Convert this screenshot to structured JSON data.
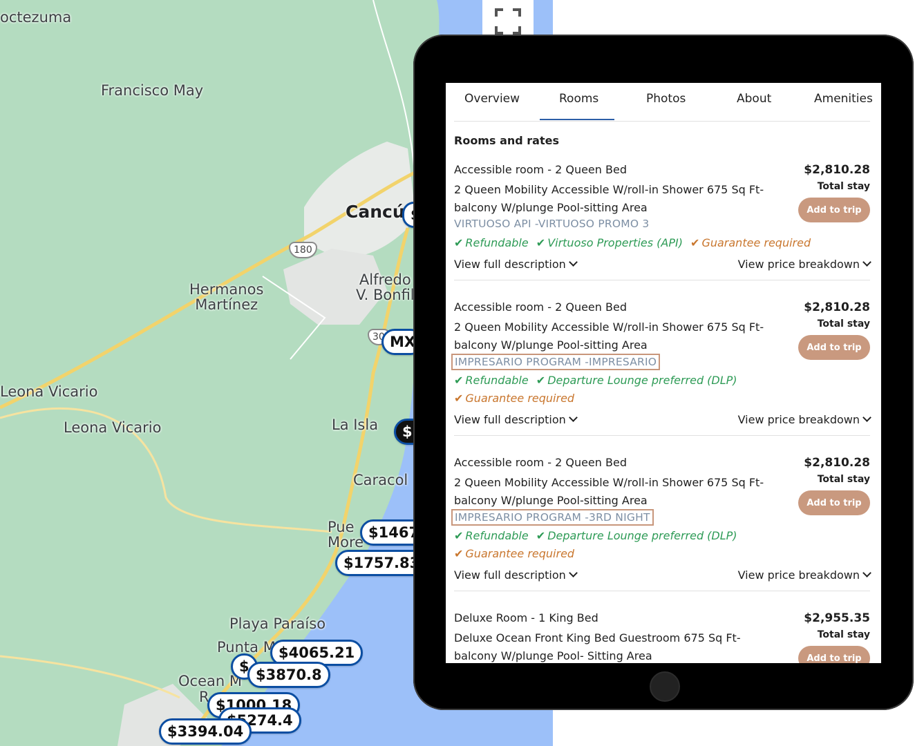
{
  "map": {
    "places": [
      {
        "label": "octezuma"
      },
      {
        "label": "Francisco May"
      },
      {
        "label": "Cancú"
      },
      {
        "label": "Hermanos\nMartínez"
      },
      {
        "label": "Alfredo\nV. Bonfil"
      },
      {
        "label": "Leona Vicario"
      },
      {
        "label": "Leona Vicario"
      },
      {
        "label": "La Isla"
      },
      {
        "label": "Caracol"
      },
      {
        "label": "Pue\nMore"
      },
      {
        "label": "Playa Paraíso"
      },
      {
        "label": "Punta M"
      },
      {
        "label": "Ocean M"
      },
      {
        "label": "R"
      }
    ],
    "road_shields": [
      "180",
      "30"
    ],
    "price_pins": [
      "$1467",
      "$1757.83",
      "$4065.21",
      "$3870.8",
      "$",
      "$1000.18",
      "$5274.4",
      "$3394.04",
      "MX",
      "$2",
      "$"
    ],
    "fullscreen_icon": "fullscreen-icon",
    "colors": {
      "land": "#b4dcc0",
      "water": "#9cc0f9",
      "road": "#f2d36b",
      "pin_border": "#0b4ea2"
    }
  },
  "tablet": {
    "tabs": [
      {
        "label": "Overview"
      },
      {
        "label": "Rooms",
        "active": true
      },
      {
        "label": "Photos"
      },
      {
        "label": "About"
      },
      {
        "label": "Amenities"
      }
    ],
    "section_title": "Rooms and rates",
    "rooms": [
      {
        "name": "Accessible room - 2 Queen Bed",
        "description": "2 Queen Mobility Accessible W/roll-in Shower 675 Sq Ft-balcony W/plunge Pool-sitting Area",
        "promo": "VIRTUOSO API -VIRTUOSO PROMO 3",
        "price": "$2,810.28",
        "stay_label": "Total stay",
        "add_label": "Add to trip",
        "features_line1": [
          {
            "label": "Refundable",
            "type": "ok"
          },
          {
            "label": "Virtuoso Properties (API)",
            "type": "ok"
          },
          {
            "label": "Guarantee required",
            "type": "warn"
          }
        ],
        "features_line2": [],
        "view_description": "View full description",
        "view_breakdown": "View price breakdown"
      },
      {
        "name": "Accessible room - 2 Queen Bed",
        "description": "2 Queen Mobility Accessible W/roll-in Shower 675 Sq Ft-balcony W/plunge Pool-sitting Area",
        "promo": "IMPRESARIO PROGRAM -IMPRESARIO",
        "price": "$2,810.28",
        "stay_label": "Total stay",
        "add_label": "Add to trip",
        "features_line1": [
          {
            "label": "Refundable",
            "type": "ok"
          },
          {
            "label": "Departure Lounge preferred (DLP)",
            "type": "ok"
          }
        ],
        "features_line2": [
          {
            "label": "Guarantee required",
            "type": "warn"
          }
        ],
        "view_description": "View full description",
        "view_breakdown": "View price breakdown"
      },
      {
        "name": "Accessible room - 2 Queen Bed",
        "description": "2 Queen Mobility Accessible W/roll-in Shower 675 Sq Ft-balcony W/plunge Pool-sitting Area",
        "promo": "IMPRESARIO PROGRAM -3RD NIGHT",
        "price": "$2,810.28",
        "stay_label": "Total stay",
        "add_label": "Add to trip",
        "features_line1": [
          {
            "label": "Refundable",
            "type": "ok"
          },
          {
            "label": "Departure Lounge preferred (DLP)",
            "type": "ok"
          }
        ],
        "features_line2": [
          {
            "label": "Guarantee required",
            "type": "warn"
          }
        ],
        "view_description": "View full description",
        "view_breakdown": "View price breakdown"
      },
      {
        "name": "Deluxe Room - 1 King Bed",
        "description": "Deluxe Ocean Front King Bed Guestroom 675 Sq Ft-balcony W/plunge Pool- Sitting Area",
        "price": "$2,955.35",
        "stay_label": "Total stay",
        "add_label": "Add to trip"
      }
    ],
    "colors": {
      "accent_button": "#c9997f",
      "ok_green": "#2e9b56",
      "warn_orange": "#c9772f",
      "promo_gray": "#7d8fa4",
      "tab_underline": "#2b5ea7",
      "highlight_box": "#c8967b"
    }
  }
}
